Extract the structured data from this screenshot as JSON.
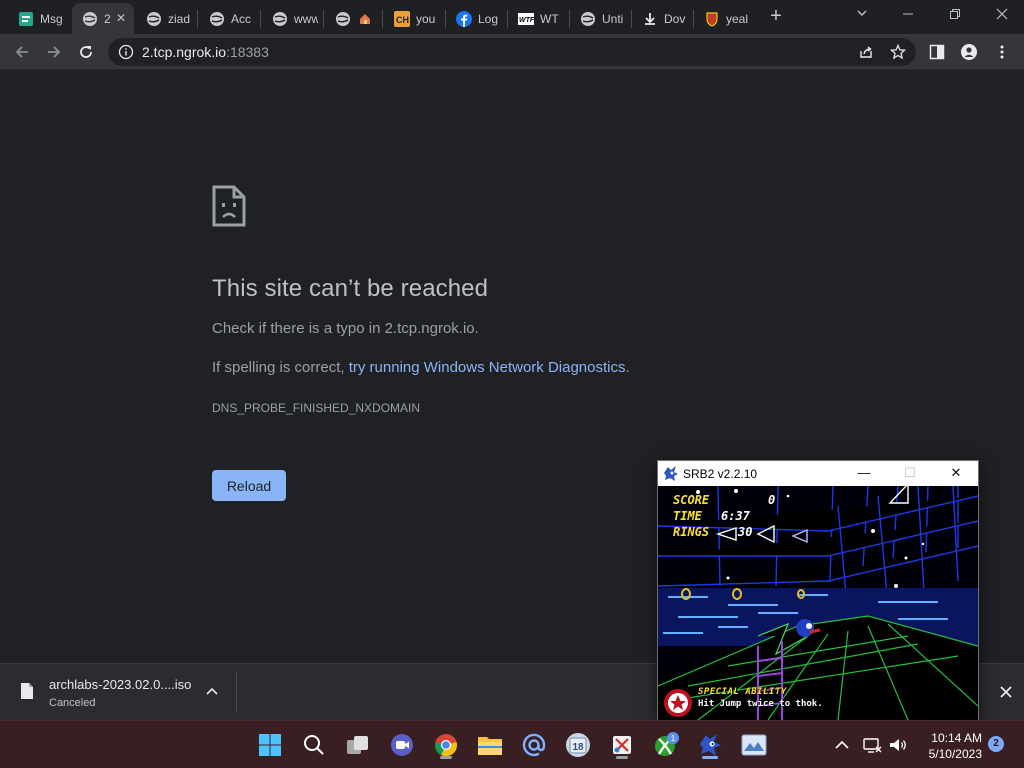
{
  "browser": {
    "tabs": [
      {
        "label": "Msg",
        "icon": "app-icon"
      },
      {
        "label": "2",
        "icon": "globe-icon",
        "active": true
      },
      {
        "label": "ziad",
        "icon": "globe-icon"
      },
      {
        "label": "Acc",
        "icon": "globe-icon"
      },
      {
        "label": "www",
        "icon": "globe-icon"
      },
      {
        "label": "",
        "icon": "house-icon"
      },
      {
        "label": "you",
        "icon": "ch-icon"
      },
      {
        "label": "Log",
        "icon": "facebook-icon"
      },
      {
        "label": "WT",
        "icon": "wtf-icon"
      },
      {
        "label": "Unti",
        "icon": "globe-icon"
      },
      {
        "label": "Dov",
        "icon": "download-icon"
      },
      {
        "label": "yeal",
        "icon": "crest-icon"
      }
    ],
    "address": {
      "host": "2.tcp.ngrok.io",
      "port": ":18383"
    }
  },
  "error_page": {
    "title": "This site can’t be reached",
    "line1": "Check if there is a typo in 2.tcp.ngrok.io.",
    "line2_prefix": "If spelling is correct, ",
    "line2_link": "try running Windows Network Diagnostics",
    "line2_suffix": ".",
    "code": "DNS_PROBE_FINISHED_NXDOMAIN",
    "reload_label": "Reload"
  },
  "download": {
    "filename": "archlabs-2023.02.0....iso",
    "status": "Canceled"
  },
  "srb2": {
    "title": "SRB2 v2.2.10",
    "score_label": "SCORE",
    "score_value": "0",
    "time_label": "TIME",
    "time_value": "6:37",
    "rings_label": "RINGS",
    "rings_value": "30",
    "ability_title": "SPECIAL ABILITY",
    "ability_text": "Hit Jump twice to thok."
  },
  "taskbar": {
    "xbox_badge": "1",
    "calendar_day": "18",
    "time": "10:14 AM",
    "date": "5/10/2023",
    "notifications": "2"
  },
  "colors": {
    "page_bg": "#202124",
    "link": "#8ab4f8",
    "button": "#8ab4f8",
    "taskbar": "#3a1f22"
  }
}
